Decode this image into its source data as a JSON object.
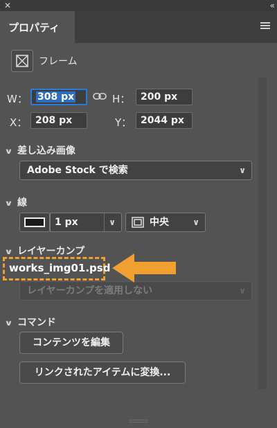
{
  "window": {
    "close_glyph": "✕",
    "collapse_glyph": "«"
  },
  "tab": {
    "label": "プロパティ"
  },
  "frame": {
    "label": "フレーム"
  },
  "transform": {
    "w_label": "W：",
    "w_value": "308 px",
    "h_label": "H：",
    "h_value": "200 px",
    "x_label": "X：",
    "x_value": "208 px",
    "y_label": "Y：",
    "y_value": "2044 px"
  },
  "sections": {
    "embedded_image": "差し込み画像",
    "stroke": "線",
    "layer_comp": "レイヤーカンプ",
    "command": "コマンド"
  },
  "embedded_image": {
    "search_select": "Adobe Stock で検索"
  },
  "stroke": {
    "weight": "1 px",
    "align": "中央"
  },
  "layer_comp": {
    "file_name": "works_img01.psd",
    "comp_select": "レイヤーカンプを適用しない"
  },
  "commands": {
    "edit_contents": "コンテンツを編集",
    "convert_linked": "リンクされたアイテムに変換..."
  },
  "colors": {
    "panel_bg": "#535353",
    "accent_arrow": "#f0a030",
    "focus_border": "#2b7bd8"
  },
  "icons": [
    "close-icon",
    "collapse-icon",
    "panel-menu-icon",
    "frame-icon",
    "link-chain-icon",
    "chevron-down-icon",
    "stroke-style-icon",
    "align-center-icon",
    "arrow-annotation-icon"
  ]
}
